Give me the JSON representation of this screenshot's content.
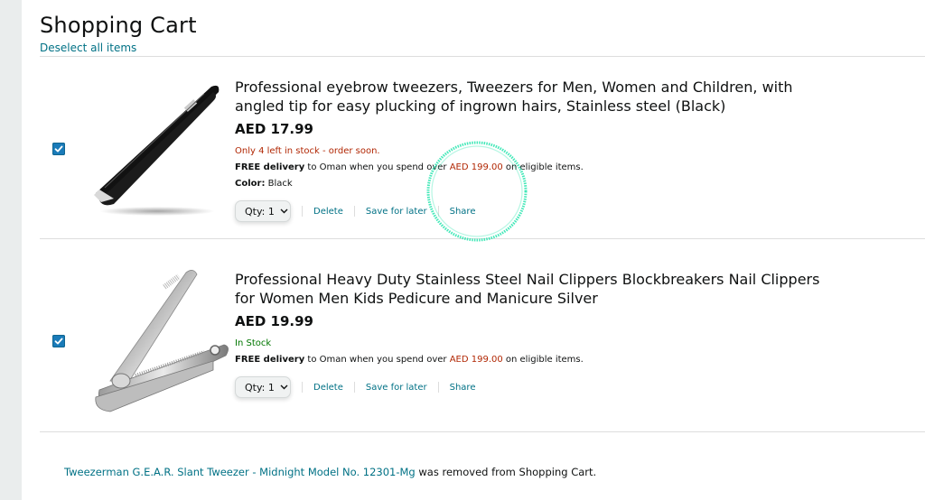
{
  "cart": {
    "title": "Shopping Cart",
    "deselect_label": "Deselect all items"
  },
  "items": [
    {
      "title": "Professional eyebrow tweezers, Tweezers for Men, Women and Children, with angled tip for easy plucking of ingrown hairs, Stainless steel (Black)",
      "price": "AED 17.99",
      "stock": "Only 4 left in stock - order soon.",
      "delivery_free": "FREE delivery",
      "delivery_mid": " to Oman when you spend over ",
      "delivery_amount": "AED 199.00",
      "delivery_end": " on eligible items.",
      "color_label": "Color:",
      "color_value": " Black",
      "qty_label": "Qty: 1",
      "delete_label": "Delete",
      "save_label": "Save for later",
      "share_label": "Share",
      "checked": true
    },
    {
      "title": "Professional Heavy Duty Stainless Steel Nail Clippers Blockbreakers Nail Clippers for Women Men Kids Pedicure and Manicure Silver",
      "price": "AED 19.99",
      "stock": "In Stock",
      "delivery_free": "FREE delivery",
      "delivery_mid": " to Oman when you spend over ",
      "delivery_amount": "AED 199.00",
      "delivery_end": " on eligible items.",
      "qty_label": "Qty: 1",
      "delete_label": "Delete",
      "save_label": "Save for later",
      "share_label": "Share",
      "checked": true
    }
  ],
  "removed_notice": {
    "product_link": "Tweezerman G.E.A.R. Slant Tweezer - Midnight Model No. 12301-Mg",
    "suffix": " was removed from Shopping Cart."
  },
  "colors": {
    "link": "#007185",
    "price_red": "#b12704",
    "in_stock_green": "#007600",
    "checkbox_blue": "#1a7bb9",
    "highlight_ring": "#2ee6b0"
  }
}
